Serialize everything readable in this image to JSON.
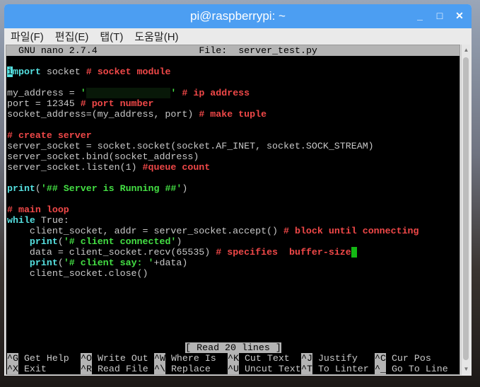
{
  "window": {
    "title": "pi@raspberrypi: ~",
    "controls": [
      "_",
      "□",
      "✕"
    ]
  },
  "menu": [
    "파일(F)",
    "편집(E)",
    "탭(T)",
    "도움말(H)"
  ],
  "nano": {
    "version": "GNU nano 2.7.4",
    "file_label": "File:",
    "file_name": "server_test.py"
  },
  "code": [
    [],
    [
      [
        "curs",
        "i"
      ],
      [
        "kw",
        "mport"
      ],
      [
        "tx",
        " socket "
      ],
      [
        "cm",
        "# socket module"
      ]
    ],
    [],
    [
      [
        "tx",
        "my_address = "
      ],
      [
        "st",
        "'"
      ],
      [
        "redact",
        "               "
      ],
      [
        "st",
        "'"
      ],
      [
        "tx",
        " "
      ],
      [
        "cm",
        "# ip address"
      ]
    ],
    [
      [
        "tx",
        "port = 12345 "
      ],
      [
        "cm",
        "# port number"
      ]
    ],
    [
      [
        "tx",
        "socket_address=(my_address, port) "
      ],
      [
        "cm",
        "# make tuple"
      ]
    ],
    [],
    [
      [
        "cm",
        "# create server"
      ]
    ],
    [
      [
        "tx",
        "server_socket = socket.socket(socket.AF_INET, socket.SOCK_STREAM)"
      ]
    ],
    [
      [
        "tx",
        "server_socket.bind(socket_address)"
      ]
    ],
    [
      [
        "tx",
        "server_socket.listen(1) "
      ],
      [
        "cm",
        "#queue count"
      ]
    ],
    [],
    [
      [
        "kw",
        "print"
      ],
      [
        "tx",
        "("
      ],
      [
        "st",
        "'## Server is Running ##'"
      ],
      [
        "tx",
        ")"
      ]
    ],
    [],
    [
      [
        "cm",
        "# main loop"
      ]
    ],
    [
      [
        "kw",
        "while"
      ],
      [
        "tx",
        " True:"
      ]
    ],
    [
      [
        "tx",
        "    client_socket, addr = server_socket.accept() "
      ],
      [
        "cm",
        "# block until connecting"
      ]
    ],
    [
      [
        "tx",
        "    "
      ],
      [
        "kw",
        "print"
      ],
      [
        "tx",
        "("
      ],
      [
        "st",
        "'# client connected'"
      ],
      [
        "tx",
        ")"
      ]
    ],
    [
      [
        "tx",
        "    data = client_socket.recv(65535) "
      ],
      [
        "cm",
        "# specifies  buffer-size"
      ],
      [
        "cur2",
        " "
      ]
    ],
    [
      [
        "tx",
        "    "
      ],
      [
        "kw",
        "print"
      ],
      [
        "tx",
        "("
      ],
      [
        "st",
        "'# client say: '"
      ],
      [
        "tx",
        "+data)"
      ]
    ],
    [
      [
        "tx",
        "    client_socket.close()"
      ]
    ]
  ],
  "status": "[ Read 20 lines ]",
  "shortcuts": [
    [
      {
        "key": "^G",
        "label": "Get Help"
      },
      {
        "key": "^O",
        "label": "Write Out"
      },
      {
        "key": "^W",
        "label": "Where Is"
      },
      {
        "key": "^K",
        "label": "Cut Text"
      },
      {
        "key": "^J",
        "label": "Justify"
      },
      {
        "key": "^C",
        "label": "Cur Pos"
      }
    ],
    [
      {
        "key": "^X",
        "label": "Exit"
      },
      {
        "key": "^R",
        "label": "Read File"
      },
      {
        "key": "^\\",
        "label": "Replace"
      },
      {
        "key": "^U",
        "label": "Uncut Text"
      },
      {
        "key": "^T",
        "label": "To Linter"
      },
      {
        "key": "^_",
        "label": "Go To Line"
      }
    ]
  ]
}
